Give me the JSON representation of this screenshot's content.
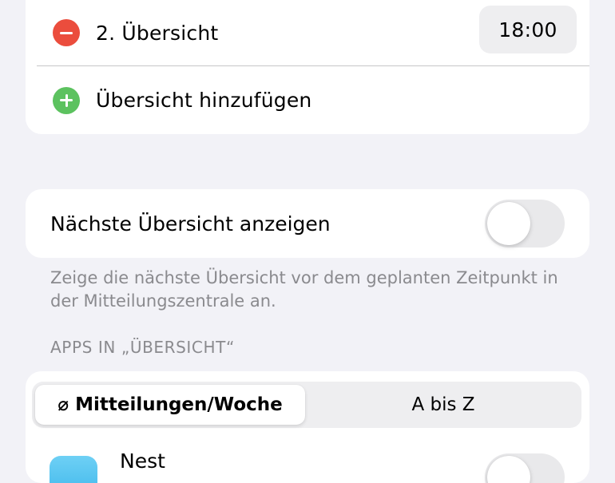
{
  "summaries": {
    "items": [
      {
        "label": "2. Übersicht",
        "time": "18:00",
        "icon": "remove-circle-icon"
      }
    ],
    "add_label": "Übersicht hinzufügen",
    "add_icon": "add-circle-icon"
  },
  "next_summary": {
    "label": "Nächste Übersicht anzeigen",
    "toggle_on": false,
    "footnote": "Zeige die nächste Übersicht vor dem geplanten Zeitpunkt in der Mitteilungszentrale an."
  },
  "apps_section": {
    "header": "APPS IN „ÜBERSICHT“",
    "sort_options": [
      "⌀ Mitteilungen/Woche",
      "A bis Z"
    ],
    "selected_sort": "⌀ Mitteilungen/Woche",
    "apps": [
      {
        "name": "Nest",
        "enabled": false
      }
    ]
  },
  "colors": {
    "background": "#f2f2f7",
    "card": "#ffffff",
    "remove": "#eb4d3d",
    "add": "#5cc25f",
    "secondary_text": "#8a8a8e"
  }
}
